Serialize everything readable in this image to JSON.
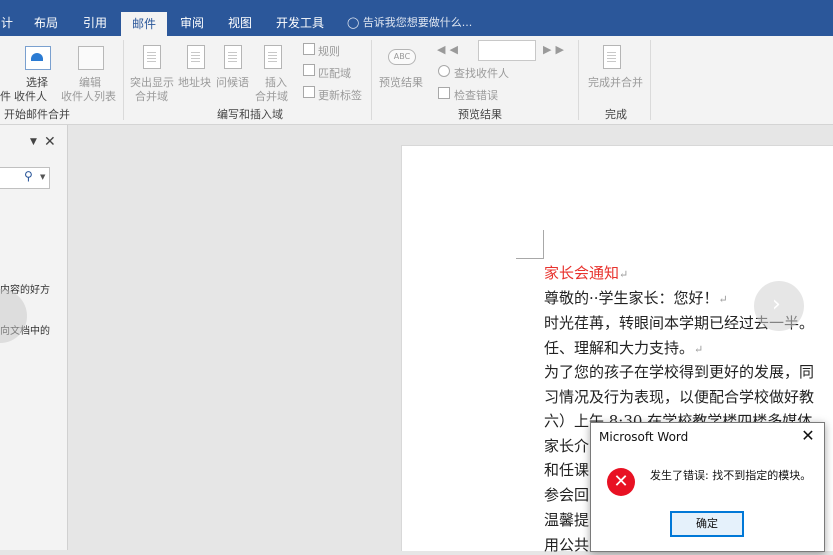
{
  "tabs": [
    {
      "label": "计",
      "active": false
    },
    {
      "label": "布局",
      "active": false
    },
    {
      "label": "引用",
      "active": false
    },
    {
      "label": "邮件",
      "active": true
    },
    {
      "label": "审阅",
      "active": false
    },
    {
      "label": "视图",
      "active": false
    },
    {
      "label": "开发工具",
      "active": false
    }
  ],
  "tell_me": "告诉我您想要做什么...",
  "ribbon": {
    "start_group": {
      "select_label": "选择",
      "recipients_label": "收件人",
      "edit_label": "编辑",
      "list_label": "收件人列表",
      "partial_left": "件",
      "group_label": "开始邮件合并"
    },
    "write_group": {
      "highlight_label_1": "突出显示",
      "highlight_label_2": "合并域",
      "address_block": "地址块",
      "greeting": "问候语",
      "insert_label_1": "插入",
      "insert_label_2": "合并域",
      "rules": "规则",
      "match_fields": "匹配域",
      "update_labels": "更新标签",
      "group_label": "编写和插入域"
    },
    "preview_group": {
      "preview_results": "预览结果",
      "record_value": "",
      "find_recipient": "查找收件人",
      "check_errors": "检查错误",
      "group_label": "预览结果"
    },
    "finish_group": {
      "finish_merge": "完成并合并",
      "group_label": "完成"
    }
  },
  "left_pane": {
    "snippet_1": "内容的好方",
    "snippet_2": "向文档中的"
  },
  "document": {
    "title": "家长会通知",
    "lines": [
      "尊敬的··学生家长：您好！",
      "时光荏苒，转眼间本学期已经过去一半。",
      "任、理解和大力支持。",
      "为了您的孩子在学校得到更好的发展，同",
      "习情况及行为表现，以便配合学校做好教",
      "六）上午 8:30 在学校教学楼四楼多媒体",
      "家长介",
      "和任课",
      "参会回",
      "温馨提",
      "用公共交通出行。"
    ],
    "title_color": "#e8322d"
  },
  "dialog": {
    "title": "Microsoft Word",
    "message": "发生了错误: 找不到指定的模块。",
    "ok_label": "确定",
    "icon": "error-icon"
  },
  "colors": {
    "ribbon_blue": "#2b579a",
    "error_red": "#e81123",
    "focus_blue": "#0078d7"
  }
}
